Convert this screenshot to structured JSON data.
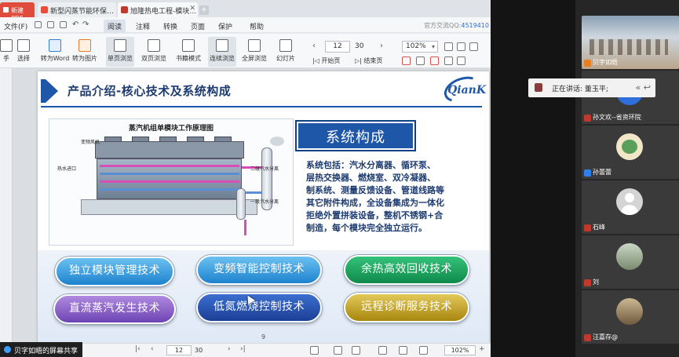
{
  "tabs": {
    "brand": "新建PDF",
    "tab1": "新型闪蒸节能环保…",
    "tab2": "旭隆热电工程-模块…",
    "new_tab": "+"
  },
  "menu": {
    "file": "文件(F)",
    "items": [
      "阅读",
      "注释",
      "转换",
      "页面",
      "保护",
      "帮助"
    ],
    "qq": "官方交流QQ:",
    "qq_number": "4519410"
  },
  "toolbar": {
    "hand": "手",
    "select": "选择",
    "to_word": "转为Word",
    "to_image": "转为图片",
    "single_page": "单页浏览",
    "double_page": "双页浏览",
    "bookmark": "书籍模式",
    "continuous": "连续浏览",
    "fullscreen": "全屏浏览",
    "slideshow": "幻灯片",
    "page_current": "12",
    "page_total": "30",
    "first_page": "开始页",
    "last_page": "结束页",
    "zoom": "102%"
  },
  "slide": {
    "title": "产品介绍-核心技术及系统构成",
    "logo": "QianK",
    "diagram_title": "蒸汽机组单模块工作原理图",
    "diagram_labels": {
      "fan": "变频风机",
      "inlet": "热水进口",
      "level2": "二级汽水分离",
      "level1": "一级汽水分离"
    },
    "system_heading": "系统构成",
    "system_desc": "系统包括：汽水分离器、循环泵、\n层热交换器、燃烧室、双冷凝器、\n制系统、测量反馈设备、管道线路等\n其它附件构成，全设备集成为一体化\n拒绝外置拼装设备，整机不锈钢+合\n制造，每个模块完全独立运行。",
    "pills": [
      "独立模块管理技术",
      "变频智能控制技术",
      "余热高效回收技术",
      "直流蒸汽发生技术",
      "低氮燃烧控制技术",
      "远程诊断服务技术"
    ],
    "page_number": "9"
  },
  "statusbar": {
    "share_label": "贝字如晤的屏幕共享",
    "page_current": "12",
    "page_total": "30",
    "zoom": "102%"
  },
  "meeting": {
    "speaking_label": "正在讲话: 董玉平;",
    "participants": [
      {
        "name": "贝字如晤"
      },
      {
        "name": "孙文欢--省资环院"
      },
      {
        "name": "孙蕾蕾"
      },
      {
        "name": "石峰"
      },
      {
        "name": "刘"
      },
      {
        "name": "汪嘉存@"
      }
    ]
  }
}
